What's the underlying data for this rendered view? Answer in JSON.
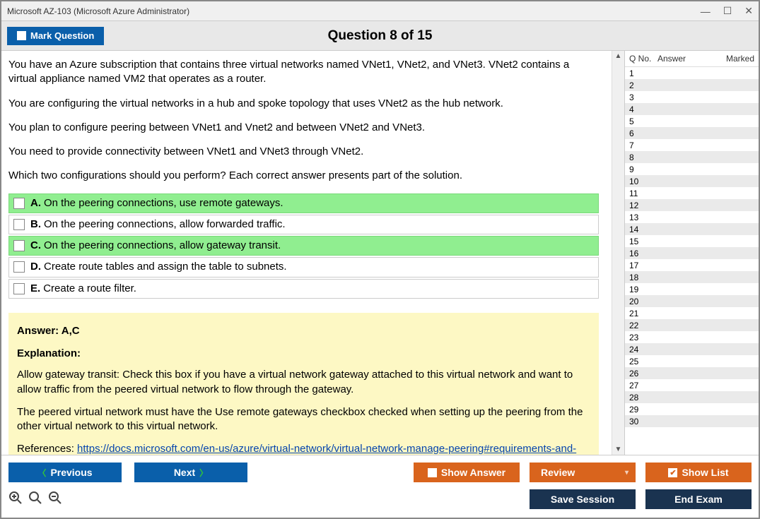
{
  "window": {
    "title": "Microsoft AZ-103 (Microsoft Azure Administrator)"
  },
  "header": {
    "mark_label": "Mark Question",
    "question_title": "Question 8 of 15"
  },
  "question": {
    "paragraphs": [
      "You have an Azure subscription that contains three virtual networks named VNet1, VNet2, and VNet3. VNet2 contains a virtual appliance named VM2 that operates as a router.",
      "You are configuring the virtual networks in a hub and spoke topology that uses VNet2 as the hub network.",
      "You plan to configure peering between VNet1 and Vnet2 and between VNet2 and VNet3.",
      "You need to provide connectivity between VNet1 and VNet3 through VNet2.",
      "Which two configurations should you perform? Each correct answer presents part of the solution."
    ],
    "options": [
      {
        "letter": "A.",
        "text": "On the peering connections, use remote gateways.",
        "correct": true
      },
      {
        "letter": "B.",
        "text": "On the peering connections, allow forwarded traffic.",
        "correct": false
      },
      {
        "letter": "C.",
        "text": "On the peering connections, allow gateway transit.",
        "correct": true
      },
      {
        "letter": "D.",
        "text": "Create route tables and assign the table to subnets.",
        "correct": false
      },
      {
        "letter": "E.",
        "text": "Create a route filter.",
        "correct": false
      }
    ]
  },
  "answer": {
    "title": "Answer: A,C",
    "exp_label": "Explanation:",
    "p1": "Allow gateway transit: Check this box if you have a virtual network gateway attached to this virtual network and want to allow traffic from the peered virtual network to flow through the gateway.",
    "p2": "The peered virtual network must have the Use remote gateways checkbox checked when setting up the peering from the other virtual network to this virtual network.",
    "ref_label": "References: ",
    "ref_link": "https://docs.microsoft.com/en-us/azure/virtual-network/virtual-network-manage-peering#requirements-and-constraints"
  },
  "sidebar": {
    "head": {
      "qno": "Q No.",
      "answer": "Answer",
      "marked": "Marked"
    },
    "count": 30
  },
  "footer": {
    "previous": "Previous",
    "next": "Next",
    "show_answer": "Show Answer",
    "review": "Review",
    "show_list": "Show List",
    "save_session": "Save Session",
    "end_exam": "End Exam"
  }
}
